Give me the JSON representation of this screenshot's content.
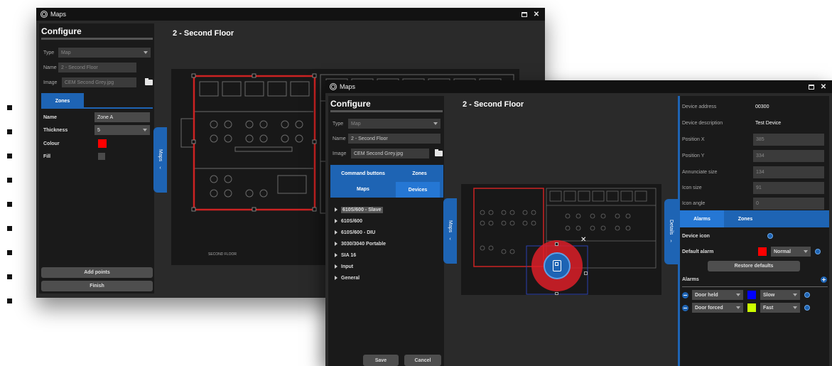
{
  "window1": {
    "title": "Maps",
    "configure_title": "Configure",
    "form": {
      "type_label": "Type",
      "type_value": "Map",
      "name_label": "Name",
      "name_value": "2 - Second Floor",
      "image_label": "Image",
      "image_value": "CEM Second Grey.jpg"
    },
    "zones_tab": "Zones",
    "zone": {
      "name_label": "Name",
      "name_value": "Zone A",
      "thickness_label": "Thickness",
      "thickness_value": "5",
      "colour_label": "Colour",
      "colour_value": "#ff0000",
      "fill_label": "Fill"
    },
    "add_points": "Add points",
    "finish": "Finish",
    "map_tab": "Maps",
    "map_title": "2 - Second Floor",
    "floor_label": "SECOND FLOOR"
  },
  "window2": {
    "title": "Maps",
    "configure_title": "Configure",
    "form": {
      "type_label": "Type",
      "type_value": "Map",
      "name_label": "Name",
      "name_value": "2 - Second Floor",
      "image_label": "Image",
      "image_value": "CEM Second Grey.jpg"
    },
    "tabs": [
      "Command buttons",
      "Zones",
      "Maps",
      "Devices"
    ],
    "devices": [
      "610S/600 - Slave",
      "610S/600",
      "610S/600 - DIU",
      "3030/3040 Portable",
      "SIA 16",
      "Input",
      "General"
    ],
    "save": "Save",
    "cancel": "Cancel",
    "map_tab": "Maps",
    "map_title": "2 - Second Floor",
    "details_tab": "Details",
    "details": [
      {
        "label": "Device address",
        "value": "00300",
        "style": "plain"
      },
      {
        "label": "Device description",
        "value": "Test Device",
        "style": "plain"
      },
      {
        "label": "Position X",
        "value": "385",
        "style": "field"
      },
      {
        "label": "Position Y",
        "value": "334",
        "style": "field"
      },
      {
        "label": "Annunciate size",
        "value": "134",
        "style": "field"
      },
      {
        "label": "Icon size",
        "value": "91",
        "style": "field"
      },
      {
        "label": "Icon angle",
        "value": "0",
        "style": "field"
      }
    ],
    "alarm_tabs": [
      "Alarms",
      "Zones"
    ],
    "device_icon_label": "Device icon",
    "default_alarm_label": "Default alarm",
    "default_alarm_color": "#ff0000",
    "default_alarm_value": "Normal",
    "restore_defaults": "Restore defaults",
    "alarms_label": "Alarms",
    "alarm_rows": [
      {
        "name": "Door held",
        "color": "#0000ff",
        "speed": "Slow"
      },
      {
        "name": "Door forced",
        "color": "#ccff00",
        "speed": "Fast"
      }
    ]
  },
  "colors": {
    "accent": "#1e64b4",
    "zone_red": "#cc2222"
  }
}
